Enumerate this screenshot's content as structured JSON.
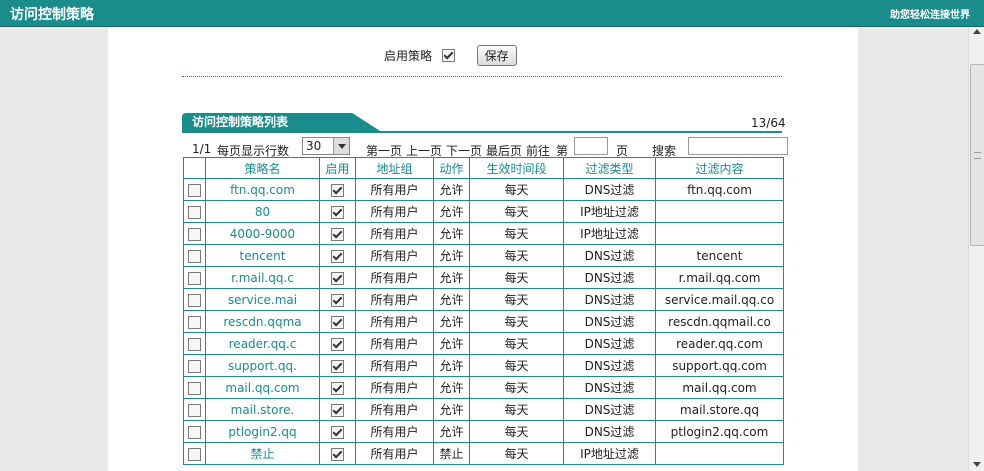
{
  "header": {
    "title": "访问控制策略",
    "slogan": "助您轻松连接世界"
  },
  "enable": {
    "label": "启用策略",
    "checked": true,
    "save_label": "保存"
  },
  "list": {
    "tab_label": "访问控制策略列表",
    "count": "13/64"
  },
  "pager": {
    "page_info": "1/1",
    "rows_label": "每页显示行数",
    "rows_value": "30",
    "first": "第一页",
    "prev": "上一页",
    "next": "下一页",
    "last": "最后页",
    "goto_label": "前往",
    "goto_prefix": "第",
    "goto_suffix": "页",
    "search_label": "搜索"
  },
  "table": {
    "headers": [
      "策略名",
      "启用",
      "地址组",
      "动作",
      "生效时间段",
      "过滤类型",
      "过滤内容"
    ],
    "rows": [
      {
        "name": "ftn.qq.com",
        "group": "所有用户",
        "action": "允许",
        "time": "每天",
        "type": "DNS过滤",
        "content": "ftn.qq.com"
      },
      {
        "name": "80",
        "group": "所有用户",
        "action": "允许",
        "time": "每天",
        "type": "IP地址过滤",
        "content": ""
      },
      {
        "name": "4000-9000",
        "group": "所有用户",
        "action": "允许",
        "time": "每天",
        "type": "IP地址过滤",
        "content": ""
      },
      {
        "name": "tencent",
        "group": "所有用户",
        "action": "允许",
        "time": "每天",
        "type": "DNS过滤",
        "content": "tencent"
      },
      {
        "name": "r.mail.qq.c",
        "group": "所有用户",
        "action": "允许",
        "time": "每天",
        "type": "DNS过滤",
        "content": "r.mail.qq.com"
      },
      {
        "name": "service.mai",
        "group": "所有用户",
        "action": "允许",
        "time": "每天",
        "type": "DNS过滤",
        "content": "service.mail.qq.co"
      },
      {
        "name": "rescdn.qqma",
        "group": "所有用户",
        "action": "允许",
        "time": "每天",
        "type": "DNS过滤",
        "content": "rescdn.qqmail.co"
      },
      {
        "name": "reader.qq.c",
        "group": "所有用户",
        "action": "允许",
        "time": "每天",
        "type": "DNS过滤",
        "content": "reader.qq.com"
      },
      {
        "name": "support.qq.",
        "group": "所有用户",
        "action": "允许",
        "time": "每天",
        "type": "DNS过滤",
        "content": "support.qq.com"
      },
      {
        "name": "mail.qq.com",
        "group": "所有用户",
        "action": "允许",
        "time": "每天",
        "type": "DNS过滤",
        "content": "mail.qq.com"
      },
      {
        "name": "mail.store.",
        "group": "所有用户",
        "action": "允许",
        "time": "每天",
        "type": "DNS过滤",
        "content": "mail.store.qq"
      },
      {
        "name": "ptlogin2.qq",
        "group": "所有用户",
        "action": "允许",
        "time": "每天",
        "type": "DNS过滤",
        "content": "ptlogin2.qq.com"
      },
      {
        "name": "禁止",
        "group": "所有用户",
        "action": "禁止",
        "time": "每天",
        "type": "IP地址过滤",
        "content": ""
      }
    ]
  }
}
